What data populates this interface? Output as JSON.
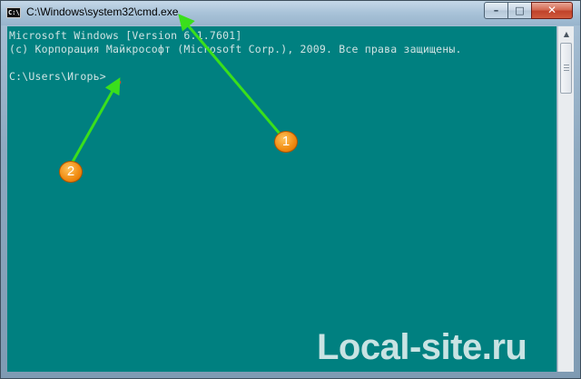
{
  "window": {
    "title": "C:\\Windows\\system32\\cmd.exe",
    "app_icon_text": "C:\\",
    "buttons": {
      "minimize": "–",
      "maximize": "□",
      "close": "✕"
    }
  },
  "console": {
    "lines": [
      "Microsoft Windows [Version 6.1.7601]",
      "(c) Корпорация Майкрософт (Microsoft Corp.), 2009. Все права защищены.",
      "",
      "C:\\Users\\Игорь>"
    ]
  },
  "annotations": {
    "badge_1": "1",
    "badge_2": "2"
  },
  "watermark": "Local-site.ru",
  "colors": {
    "console_bg": "#008080",
    "console_text": "#cfe3e3",
    "arrow": "#3adf1c",
    "badge": "#f08a10",
    "cursor": "#e03a2a"
  }
}
